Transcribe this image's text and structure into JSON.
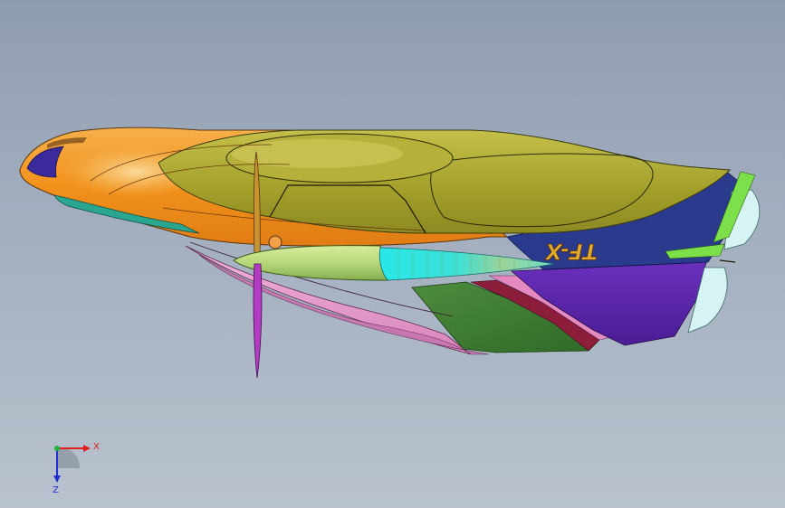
{
  "viewport": {
    "background_top": "#8f9db0",
    "background_bottom": "#b9c2ce"
  },
  "model": {
    "fuselage_marking": "TF-X",
    "colors": {
      "canopy": "#a6a42c",
      "nose": "#f59a2a",
      "nose_highlight": "#f7d890",
      "belly": "#e49ac8",
      "tail_navy": "#2a3a8c",
      "tail_purple": "#5a23a8",
      "wing_green": "#3f7d32",
      "wing_maroon": "#8c1e3c",
      "propeller": "#b23cc2",
      "spinner": "#b6d879",
      "pod_cyan": "#2fe0e0",
      "marking_color": "#e0ab2a",
      "accent_lime": "#7de04a",
      "tail_glass": "#d6f4f4"
    }
  },
  "triad": {
    "x_label": "X",
    "z_label": "Z",
    "x_color": "#e02020",
    "z_color": "#2030d0",
    "origin_color": "#20b040"
  }
}
